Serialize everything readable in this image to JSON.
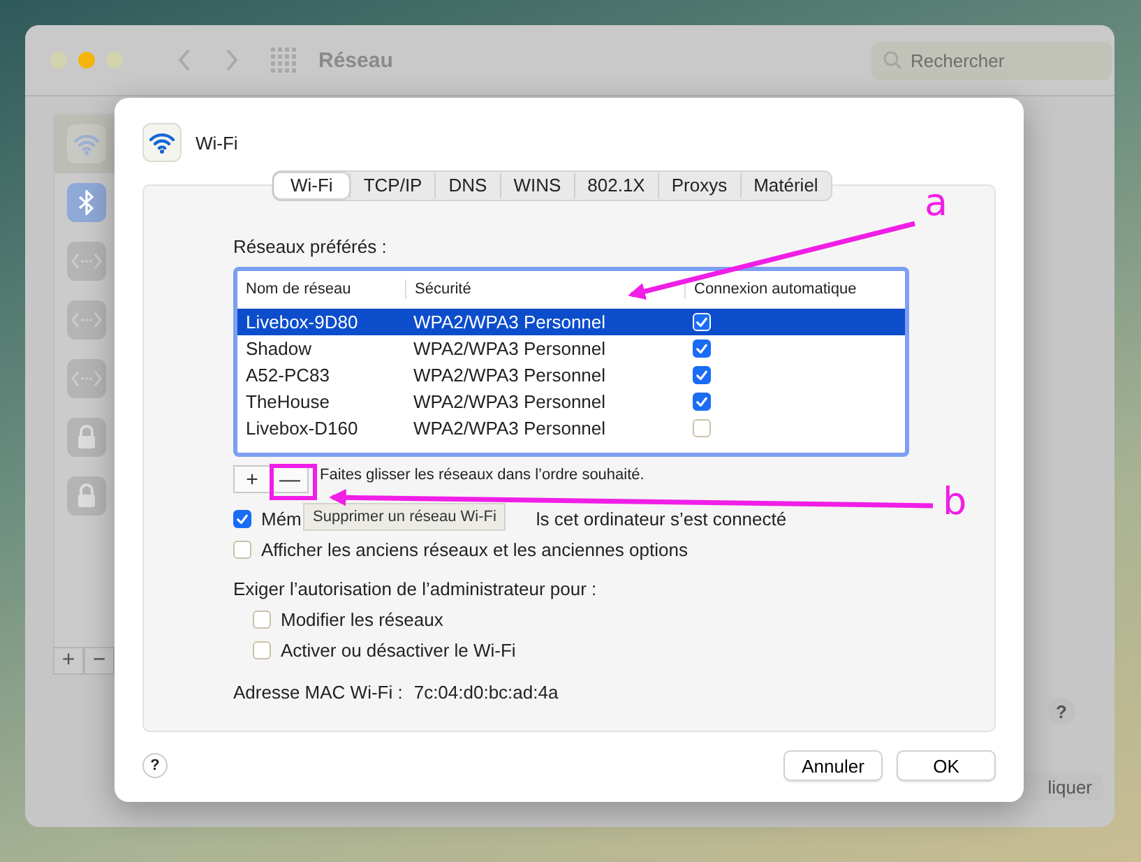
{
  "window": {
    "title": "Réseau",
    "search": {
      "placeholder": "Rechercher"
    }
  },
  "sidebar": {
    "items": [
      {
        "kind": "wifi",
        "selected": true
      },
      {
        "kind": "bluetooth",
        "selected": false
      },
      {
        "kind": "ethernet",
        "selected": false
      },
      {
        "kind": "ethernet",
        "selected": false
      },
      {
        "kind": "ethernet",
        "selected": false
      },
      {
        "kind": "lock",
        "selected": false
      },
      {
        "kind": "lock",
        "selected": false
      }
    ],
    "add": "+",
    "remove": "−"
  },
  "behind": {
    "help": "?",
    "apply_button": "liquer"
  },
  "sheet": {
    "title": "Wi-Fi",
    "tabs": [
      {
        "label": "Wi-Fi",
        "selected": true
      },
      {
        "label": "TCP/IP",
        "selected": false
      },
      {
        "label": "DNS",
        "selected": false
      },
      {
        "label": "WINS",
        "selected": false
      },
      {
        "label": "802.1X",
        "selected": false
      },
      {
        "label": "Proxys",
        "selected": false
      },
      {
        "label": "Matériel",
        "selected": false
      }
    ],
    "list_label": "Réseaux préférés :",
    "table": {
      "columns": [
        "Nom de réseau",
        "Sécurité",
        "Connexion automatique"
      ],
      "rows": [
        {
          "name": "Livebox-9D80",
          "security": "WPA2/WPA3 Personnel",
          "auto_connect": true,
          "selected": true
        },
        {
          "name": "Shadow",
          "security": "WPA2/WPA3 Personnel",
          "auto_connect": true,
          "selected": false
        },
        {
          "name": "A52-PC83",
          "security": "WPA2/WPA3 Personnel",
          "auto_connect": true,
          "selected": false
        },
        {
          "name": "TheHouse",
          "security": "WPA2/WPA3 Personnel",
          "auto_connect": true,
          "selected": false
        },
        {
          "name": "Livebox-D160",
          "security": "WPA2/WPA3 Personnel",
          "auto_connect": false,
          "selected": false
        }
      ]
    },
    "add": "+",
    "remove": "—",
    "hint": "Faites glisser les réseaux dans l’ordre souhaité.",
    "options": [
      {
        "checked": true,
        "label_parts": [
          "Mém",
          "ls cet ordinateur s’est connecté"
        ]
      },
      {
        "checked": false,
        "label_parts": [
          "Afficher les anciens réseaux et les anciennes options"
        ]
      }
    ],
    "admin_label": "Exiger l’autorisation de l’administrateur pour :",
    "admin_options": [
      {
        "checked": false,
        "label": "Modifier les réseaux"
      },
      {
        "checked": false,
        "label": "Activer ou désactiver le Wi-Fi"
      }
    ],
    "mac_label": "Adresse MAC Wi-Fi :",
    "mac_value": "7c:04:d0:bc:ad:4a",
    "help": "?",
    "buttons": [
      "Annuler",
      "OK"
    ]
  },
  "tooltip": "Supprimer un réseau Wi-Fi",
  "annotations": [
    {
      "label": "a"
    },
    {
      "label": "b"
    }
  ]
}
